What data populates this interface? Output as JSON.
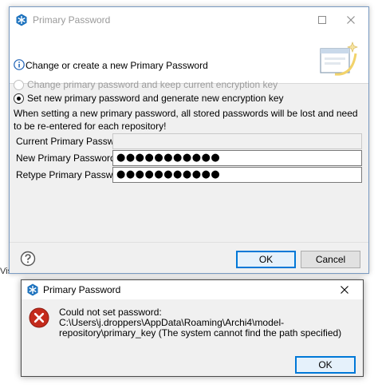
{
  "background": {
    "partial_text": "Vis"
  },
  "dialog": {
    "title": "Primary Password",
    "header_message": "Change or create a new Primary Password",
    "options": [
      {
        "label": "Change primary password and keep current encryption key",
        "enabled": false,
        "checked": false
      },
      {
        "label": "Set new primary password and generate new encryption key",
        "enabled": true,
        "checked": true
      }
    ],
    "note": "When setting a new primary password, all stored passwords will be lost and need to be re-entered for each repository!",
    "fields": {
      "current": {
        "label": "Current Primary Password:",
        "value": ""
      },
      "new": {
        "label": "New Primary Password:",
        "value": "●●●●●●●●●●●"
      },
      "retype": {
        "label": "Retype Primary Password:",
        "value": "●●●●●●●●●●●"
      }
    },
    "ok_label": "OK",
    "cancel_label": "Cancel"
  },
  "error_dialog": {
    "title": "Primary Password",
    "line1": "Could not set password:",
    "line2": "C:\\Users\\j.droppers\\AppData\\Roaming\\Archi4\\model-repository\\primary_key (The system cannot find the path specified)",
    "ok_label": "OK"
  },
  "colors": {
    "accent": "#0078d7",
    "error": "#c42b1c",
    "info": "#1a5fb4"
  }
}
